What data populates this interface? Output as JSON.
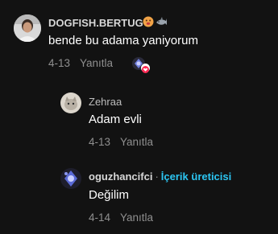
{
  "comments": [
    {
      "username": "DOGFISH.BERTUG",
      "badges": [
        "face-emoji-icon",
        "shark-emoji-icon"
      ],
      "text": "bende bu adama yaniyorum",
      "date": "4-13",
      "reply_label": "Yanıtla",
      "liked_by_creator": true,
      "avatar_icon": "person-in-white-shirt-avatar"
    },
    {
      "username": "Zehraa",
      "text": "Adam evli",
      "date": "4-13",
      "reply_label": "Yanıtla",
      "avatar_icon": "cat-photo-avatar"
    },
    {
      "username": "oguzhancifci",
      "separator": "·",
      "creator_label": "İçerik üreticisi",
      "text": "Değilim",
      "date": "4-14",
      "reply_label": "Yanıtla",
      "avatar_icon": "creator-avatar"
    }
  ],
  "colors": {
    "background": "#121212",
    "username": "#d8d8d8",
    "meta": "#8f8f8f",
    "creator_accent": "#2cc6f3",
    "like_badge": "#fe2c55"
  }
}
